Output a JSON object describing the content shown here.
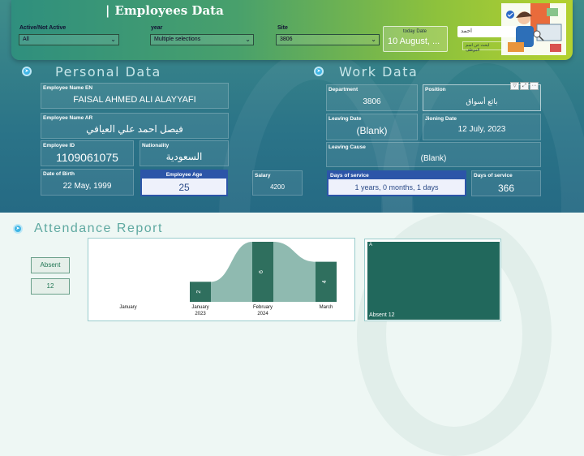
{
  "header": {
    "title": "Employees Data",
    "slicers": {
      "active": {
        "label": "Active/Not Active",
        "value": "All"
      },
      "year": {
        "label": "year",
        "value": "Multiple selections"
      },
      "site": {
        "label": "Site",
        "value": "3806"
      }
    },
    "today": {
      "label": "today Date",
      "value": "10 August, ..."
    },
    "search": {
      "value": "احمد",
      "placeholder2": "ابحث عن اسم الموظف"
    }
  },
  "personal": {
    "title": "Personal Data",
    "name_en": {
      "label": "Employee Name EN",
      "value": "FAISAL AHMED ALI ALAYYAFI"
    },
    "name_ar": {
      "label": "Employee Name AR",
      "value": "فيصل احمد علي العيافي"
    },
    "id": {
      "label": "Employee ID",
      "value": "1109061075"
    },
    "nationality": {
      "label": "Nationality",
      "value": "السعودية"
    },
    "dob": {
      "label": "Date of Birth",
      "value": "22 May, 1999"
    },
    "age": {
      "label": "Employee Age",
      "value": "25"
    },
    "salary": {
      "label": "Salary",
      "value": "4200"
    }
  },
  "work": {
    "title": "Work Data",
    "department": {
      "label": "Department",
      "value": "3806"
    },
    "position": {
      "label": "Position",
      "value": "بائع أسواق"
    },
    "leaving_date": {
      "label": "Leaving Date",
      "value": "(Blank)"
    },
    "joining_date": {
      "label": "Jioning Date",
      "value": "12 July, 2023"
    },
    "leaving_cause": {
      "label": "Leaving Cause",
      "value": "(Blank)"
    },
    "service_text": {
      "label": "Days of service",
      "value": "1 years, 0 months, 1 days"
    },
    "service_days": {
      "label": "Days of service",
      "value": "366"
    }
  },
  "attendance": {
    "title": "Attendance Report",
    "absent_label": "Absent",
    "absent_value": "12",
    "treemap": {
      "letter": "A",
      "label": "Absent 12"
    }
  },
  "colors": {
    "accent": "#2c55a8",
    "bar": "#2f6f5e",
    "ribbon": "#6aa395"
  },
  "chart_data": {
    "type": "bar",
    "categories": [
      "January",
      "February",
      "March"
    ],
    "year_labels": [
      "2023",
      "2024",
      ""
    ],
    "values": [
      2,
      6,
      4
    ],
    "title": "",
    "xlabel": "",
    "ylabel": ""
  }
}
